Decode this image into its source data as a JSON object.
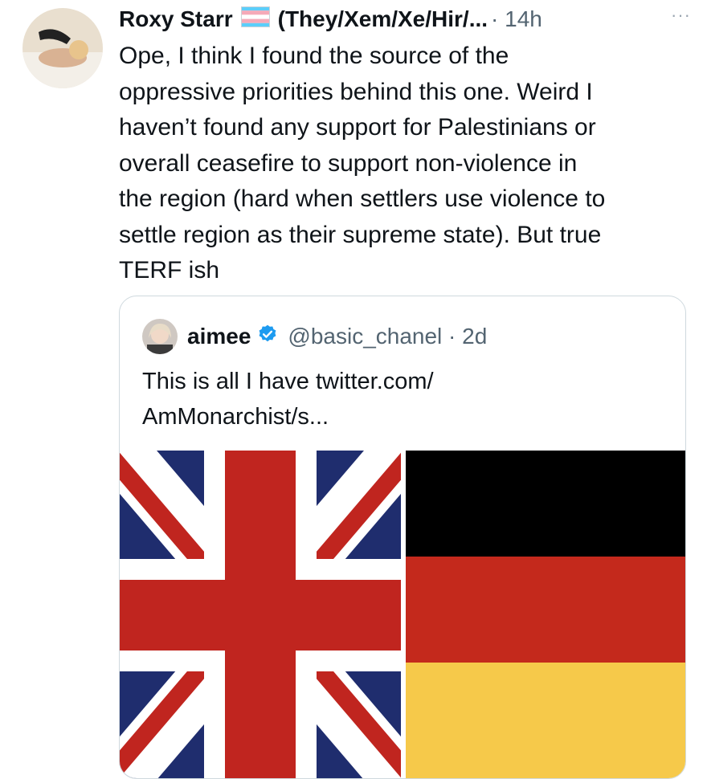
{
  "tweet": {
    "author_name": "Roxy Starr",
    "pronouns": "(They/Xem/Xe/Hir/...",
    "meta": "· 14h",
    "more": "···",
    "text": "Ope, I think I found the source of the\noppressive priorities behind this one. Weird I\nhaven’t found any support for Palestinians or\noverall ceasefire to support non-violence in\nthe region (hard when settlers use violence to\nsettle region as their supreme state). But true\nTERF ish"
  },
  "quote": {
    "author_name": "aimee",
    "handle_meta": "@basic_chanel · 2d",
    "text": "This is all I have twitter.com/\nAmMonarchist/s..."
  },
  "colors": {
    "accent_verified": "#1d9bf0",
    "union_blue": "#1f2d6e",
    "union_red": "#c0251f",
    "de_black": "#000000",
    "de_red": "#c4291c",
    "de_gold": "#f6c94a"
  },
  "icons": [
    "trans-flag-icon",
    "verified-badge-icon",
    "more-icon"
  ]
}
